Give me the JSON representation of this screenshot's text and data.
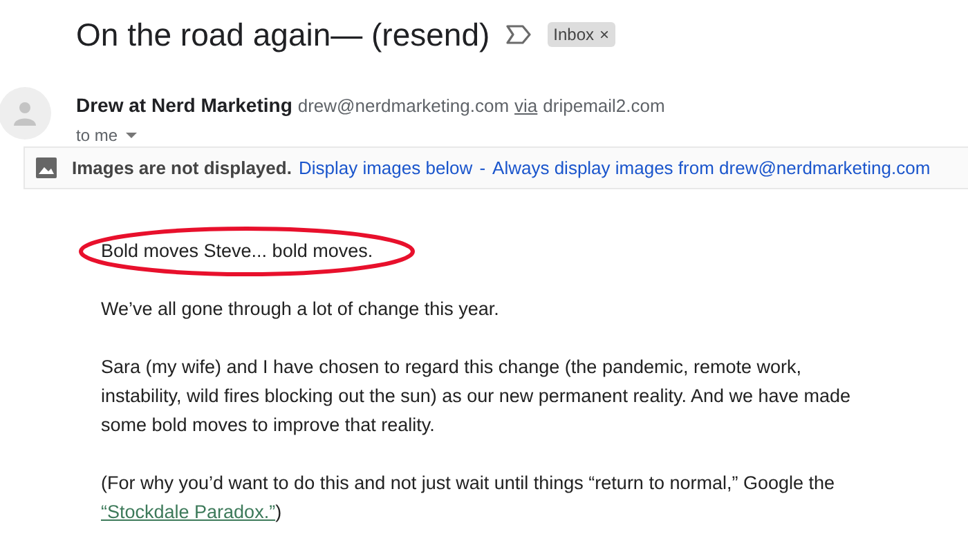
{
  "subject": {
    "title": "On the road again— (resend)",
    "important": false,
    "labels": [
      {
        "text": "Inbox",
        "close": "×"
      }
    ]
  },
  "sender": {
    "name": "Drew at Nerd Marketing",
    "email": "drew@nerdmarketing.com",
    "via": "via",
    "via_domain": "dripemail2.com",
    "recipient": "to me"
  },
  "images_banner": {
    "message": "Images are not displayed.",
    "display_link": "Display images below",
    "separator": "-",
    "always_link": "Always display images from drew@nerdmarketing.com"
  },
  "body": [
    {
      "kind": "circled",
      "text": "Bold moves Steve... bold moves."
    },
    {
      "kind": "text",
      "text": "We’ve all gone through a lot of change this year."
    },
    {
      "kind": "text",
      "text": "Sara (my wife) and I have chosen to regard this change (the pandemic, remote work, instability, wild fires blocking out the sun) as our new permanent reality. And we have made some bold moves to improve that reality."
    },
    {
      "kind": "link_end",
      "text": "(For why you’d want to do this and not just wait until things “return to normal,” Google the",
      "link": "“Stockdale Paradox.”",
      "after": ")"
    }
  ]
}
